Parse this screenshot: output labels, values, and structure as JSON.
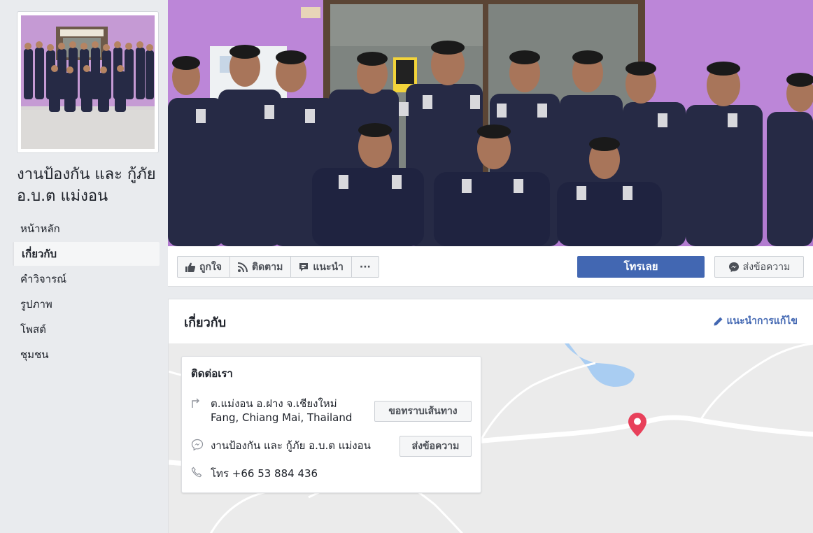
{
  "page": {
    "name": "งานป้องกัน และ กู้ภัย อ.บ.ต แม่งอน"
  },
  "sidebar": {
    "items": [
      {
        "label": "หน้าหลัก"
      },
      {
        "label": "เกี่ยวกับ"
      },
      {
        "label": "คำวิจารณ์"
      },
      {
        "label": "รูปภาพ"
      },
      {
        "label": "โพสต์"
      },
      {
        "label": "ชุมชน"
      }
    ],
    "active_index": 1
  },
  "actions": {
    "like_label": "ถูกใจ",
    "follow_label": "ติดตาม",
    "recommend_label": "แนะนำ",
    "more_label": "···",
    "call_label": "โทรเลย",
    "message_label": "ส่งข้อความ"
  },
  "about": {
    "title": "เกี่ยวกับ",
    "suggest_edit_label": "แนะนำการแก้ไข",
    "contact": {
      "title": "ติดต่อเรา",
      "address_line1": "ต.แม่งอน อ.ฝาง จ.เชียงใหม่",
      "address_line2": "Fang, Chiang Mai, Thailand",
      "directions_label": "ขอทราบเส้นทาง",
      "messenger_name": "งานป้องกัน และ กู้ภัย อ.บ.ต แม่งอน",
      "messenger_button_label": "ส่งข้อความ",
      "phone_text": "โทร +66 53 884 436"
    }
  },
  "colors": {
    "brand_blue": "#4267b2",
    "cover_wall": "#b27bd0",
    "uniform_navy": "#262a45",
    "map_pin": "#e8405a",
    "map_water": "#a9cdf2"
  }
}
